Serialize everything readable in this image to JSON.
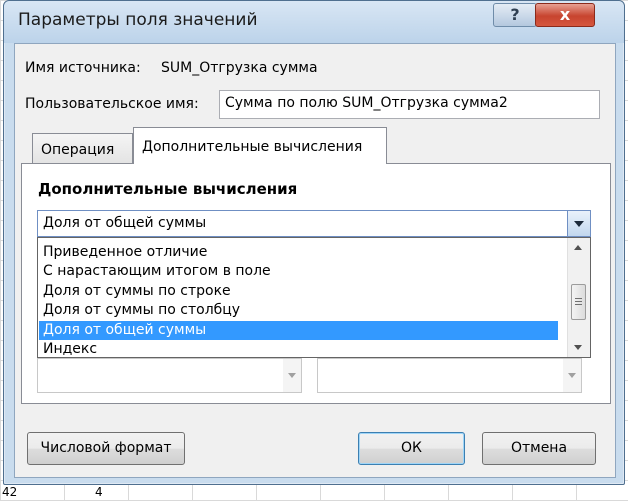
{
  "window": {
    "title": "Параметры поля значений",
    "help_glyph": "?",
    "close_glyph": "x"
  },
  "source": {
    "label": "Имя источника:",
    "value": "SUM_Отгрузка сумма"
  },
  "custom_name": {
    "label": "Пользовательское имя:",
    "value": "Сумма по полю SUM_Отгрузка сумма2"
  },
  "tabs": [
    {
      "label": "Операция"
    },
    {
      "label": "Дополнительные вычисления"
    }
  ],
  "section_title": "Дополнительные вычисления",
  "combo": {
    "value": "Доля от общей суммы",
    "options": [
      "Приведенное отличие",
      "С нарастающим итогом в поле",
      "Доля от суммы по строке",
      "Доля от суммы по столбцу",
      "Доля от общей суммы",
      "Индекс"
    ],
    "selected_index": 4
  },
  "buttons": {
    "number_format": "Числовой формат",
    "ok": "ОК",
    "cancel": "Отмена"
  },
  "background_cells": {
    "left_value": "42",
    "right_value": "4"
  }
}
